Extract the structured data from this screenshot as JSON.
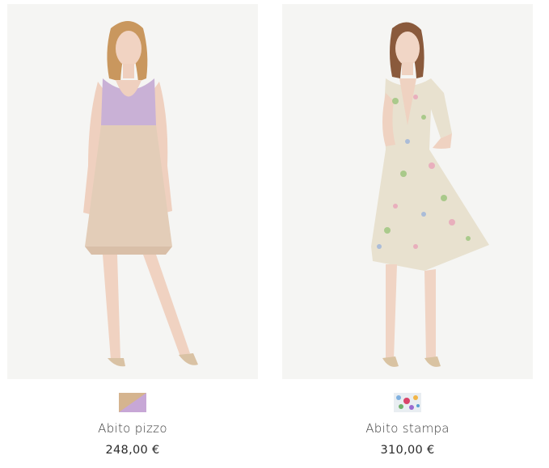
{
  "products": [
    {
      "name": "Abito pizzo",
      "price": "248,00 €",
      "image_icon": "model-lace-dress-image",
      "swatch_icon": "lilac-beige-color-swatch",
      "colors": {
        "top": "#c9b1d6",
        "skirt": "#e3cdb8",
        "swatch_a": "#d5b48f",
        "swatch_b": "#c7a7d6"
      }
    },
    {
      "name": "Abito stampa",
      "price": "310,00 €",
      "image_icon": "model-floral-dress-image",
      "swatch_icon": "floral-print-swatch",
      "colors": {
        "dress": "#e8e1cf",
        "swatch_bg": "#e9eef2"
      }
    }
  ],
  "background": "#f5f5f3"
}
